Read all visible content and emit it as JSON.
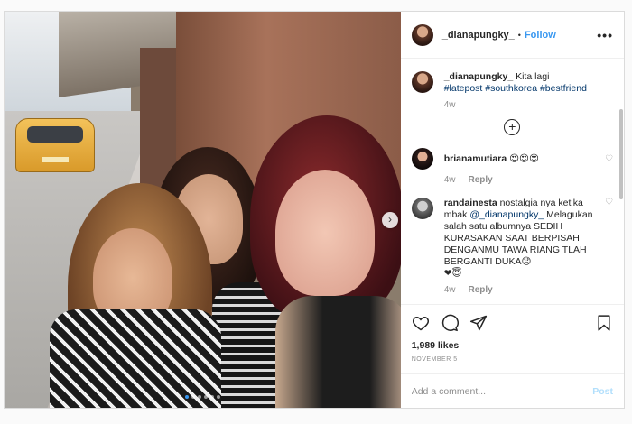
{
  "header": {
    "username": "_dianapungky_",
    "separator": "•",
    "follow_label": "Follow",
    "more_label": "•••"
  },
  "caption": {
    "username": "_dianapungky_",
    "text": "Kita lagi",
    "hashtags": "#latepost #southkorea #bestfriend",
    "time": "4w"
  },
  "load_more_label": "+",
  "comments": [
    {
      "username": "brianamutiara",
      "text": "😍😍😍",
      "time": "4w",
      "reply_label": "Reply"
    },
    {
      "username": "randainesta",
      "text_prefix": "nostalgia nya ketika mbak",
      "mention": "@_dianapungky_",
      "text_body": "Melagukan salah satu albumnya SEDIH KURASAKAN SAAT BERPISAH DENGANMU TAWA RIANG TLAH BERGANTI DUKA😞",
      "text_emojis": "❤😇",
      "time": "4w",
      "reply_label": "Reply"
    }
  ],
  "likes_text": "1,989 likes",
  "date_text": "NOVEMBER 5",
  "add_comment": {
    "placeholder": "Add a comment...",
    "post_label": "Post"
  },
  "carousel": {
    "next_label": "›",
    "slide_count": 6,
    "active_slide": 1
  },
  "colors": {
    "link_blue": "#3897f0",
    "post_disabled": "#b2dffc",
    "muted": "#8e8e8e",
    "text": "#262626"
  }
}
